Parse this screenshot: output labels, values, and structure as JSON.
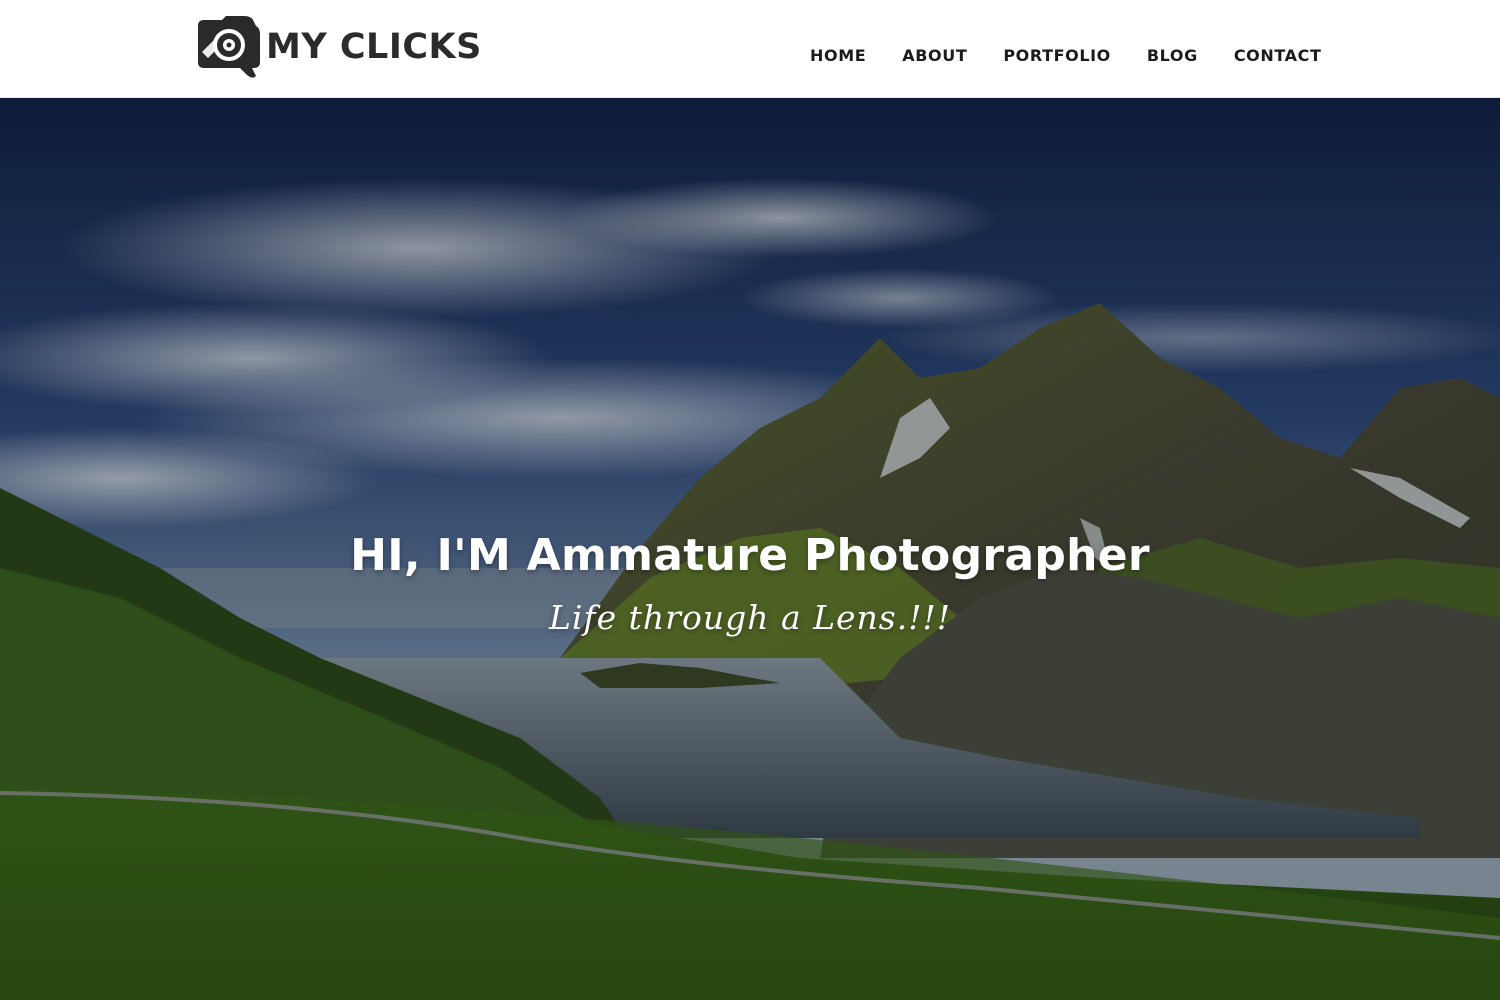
{
  "brand": {
    "name": "MY CLICKS",
    "logo_icon": "camera-lens-icon",
    "text_color": "#2b2b2b"
  },
  "nav": {
    "items": [
      {
        "label": "HOME"
      },
      {
        "label": "ABOUT"
      },
      {
        "label": "PORTFOLIO"
      },
      {
        "label": "BLOG"
      },
      {
        "label": "CONTACT"
      }
    ]
  },
  "hero": {
    "title": "HI, I'M Ammature Photographer",
    "subtitle": "Life through a Lens.!!!",
    "text_color": "#ffffff"
  }
}
